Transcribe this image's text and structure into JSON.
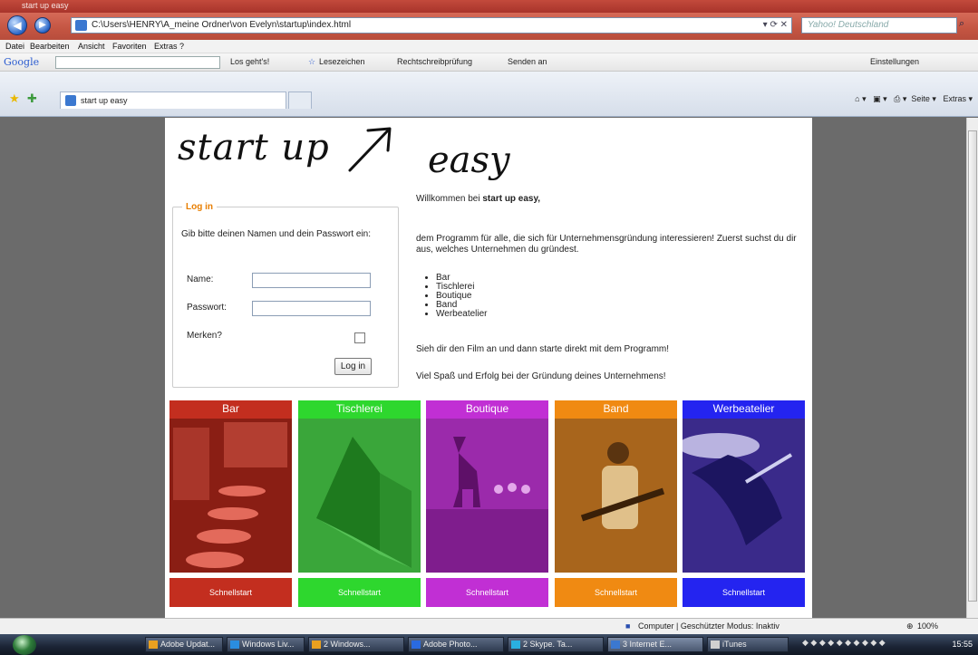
{
  "browser": {
    "address": "C:\\Users\\HENRY\\A_meine Ordner\\von Evelyn\\startup\\index.html",
    "search_placeholder": "Yahoo! Deutschland",
    "menu": [
      "Datei",
      "Bearbeiten",
      "Ansicht",
      "Favoriten",
      "Extras",
      "?"
    ],
    "google_bar": {
      "logo": "Google",
      "go_label": "Los geht's!",
      "bookmarks": "Lesezeichen",
      "spellcheck": "Rechtschreibprüfung",
      "send": "Senden an",
      "settings": "Einstellungen"
    },
    "tab_title": "start up easy",
    "tools": {
      "page": "Seite",
      "extras": "Extras"
    }
  },
  "page": {
    "logo_part1": "start up",
    "logo_part2": "easy",
    "login": {
      "legend": "Log in",
      "intro": "Gib bitte deinen Namen und dein Passwort ein:",
      "name_label": "Name:",
      "password_label": "Passwort:",
      "remember_label": "Merken?",
      "button": "Log in"
    },
    "welcome": {
      "greeting_prefix": "Willkommen bei ",
      "greeting_bold": "start up easy,",
      "intro": "dem Programm für alle, die sich für Unternehmensgründung interessieren! Zuerst suchst du dir aus, welches Unternehmen du gründest.",
      "options": [
        "Bar",
        "Tischlerei",
        "Boutique",
        "Band",
        "Werbeatelier"
      ],
      "film": "Sieh dir den Film an und dann starte direkt mit dem Programm!",
      "closing": "Viel Spaß und Erfolg bei der Gründung deines Unternehmens!"
    },
    "categories": [
      {
        "name": "Bar",
        "color": "#c32e1f"
      },
      {
        "name": "Tischlerei",
        "color": "#2ed72e"
      },
      {
        "name": "Boutique",
        "color": "#c12fd4"
      },
      {
        "name": "Band",
        "color": "#f08a12"
      },
      {
        "name": "Werbeatelier",
        "color": "#2424f0"
      }
    ],
    "quickstart_label": "Schnellstart"
  },
  "status": {
    "zone": "Computer | Geschützter Modus: Inaktiv",
    "zoom": "100%"
  },
  "taskbar": {
    "items": [
      "Adobe Updat...",
      "Windows Liv...",
      "2 Windows...",
      "Adobe Photo...",
      "2 Skype. Ta...",
      "3 Internet E...",
      "iTunes"
    ],
    "clock": "15:55"
  }
}
